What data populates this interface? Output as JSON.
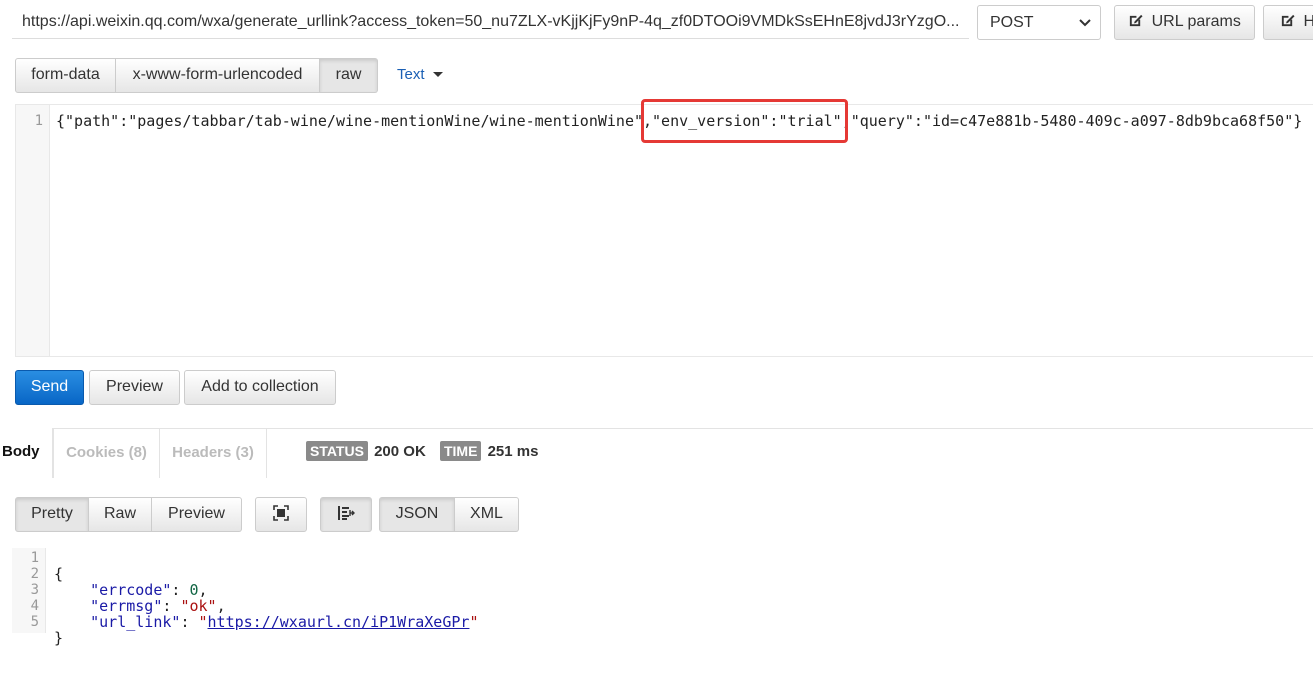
{
  "request": {
    "url": "https://api.weixin.qq.com/wxa/generate_urllink?access_token=50_nu7ZLX-vKjjKjFy9nP-4q_zf0DTOOi9VMDkSsEHnE8jvdJ3rYzgO...",
    "method": "POST",
    "method_options": [
      "POST"
    ],
    "url_params_label": "URL params",
    "headers_label": "H"
  },
  "body_tabs": {
    "form_data": "form-data",
    "urlencoded": "x-www-form-urlencoded",
    "raw": "raw",
    "text_type": "Text"
  },
  "editor": {
    "line_number": "1",
    "segments": [
      "{\"path\":\"pages/tabbar/tab-wine/wine-mentionWine/wine-mentionWine\",",
      "\"env_version\":\"trial\",",
      "\"query\":\"id=c47e881b-5480-409c-a097-8db9bca68f50\"}"
    ],
    "highlight_color": "#e53935"
  },
  "actions": {
    "send": "Send",
    "preview": "Preview",
    "add_to_collection": "Add to collection"
  },
  "response_tabs": {
    "body": "Body",
    "cookies": "Cookies (8)",
    "headers": "Headers (3)"
  },
  "status": {
    "status_label": "STATUS",
    "status_value": "200 OK",
    "time_label": "TIME",
    "time_value": "251 ms"
  },
  "view_modes": {
    "pretty": "Pretty",
    "raw": "Raw",
    "preview": "Preview",
    "json": "JSON",
    "xml": "XML"
  },
  "response": {
    "line_numbers": [
      "1",
      "2",
      "3",
      "4",
      "5"
    ],
    "open_brace": "{",
    "close_brace": "}",
    "errcode_key": "\"errcode\"",
    "errcode_value": "0",
    "errmsg_key": "\"errmsg\"",
    "errmsg_value": "\"ok\"",
    "url_link_key": "\"url_link\"",
    "url_link_value": "https://wxaurl.cn/iP1WraXeGPr"
  },
  "colors": {
    "primary_button": "#0866c6",
    "link": "#1a5fb4",
    "status_tag": "#8a8a8a"
  }
}
